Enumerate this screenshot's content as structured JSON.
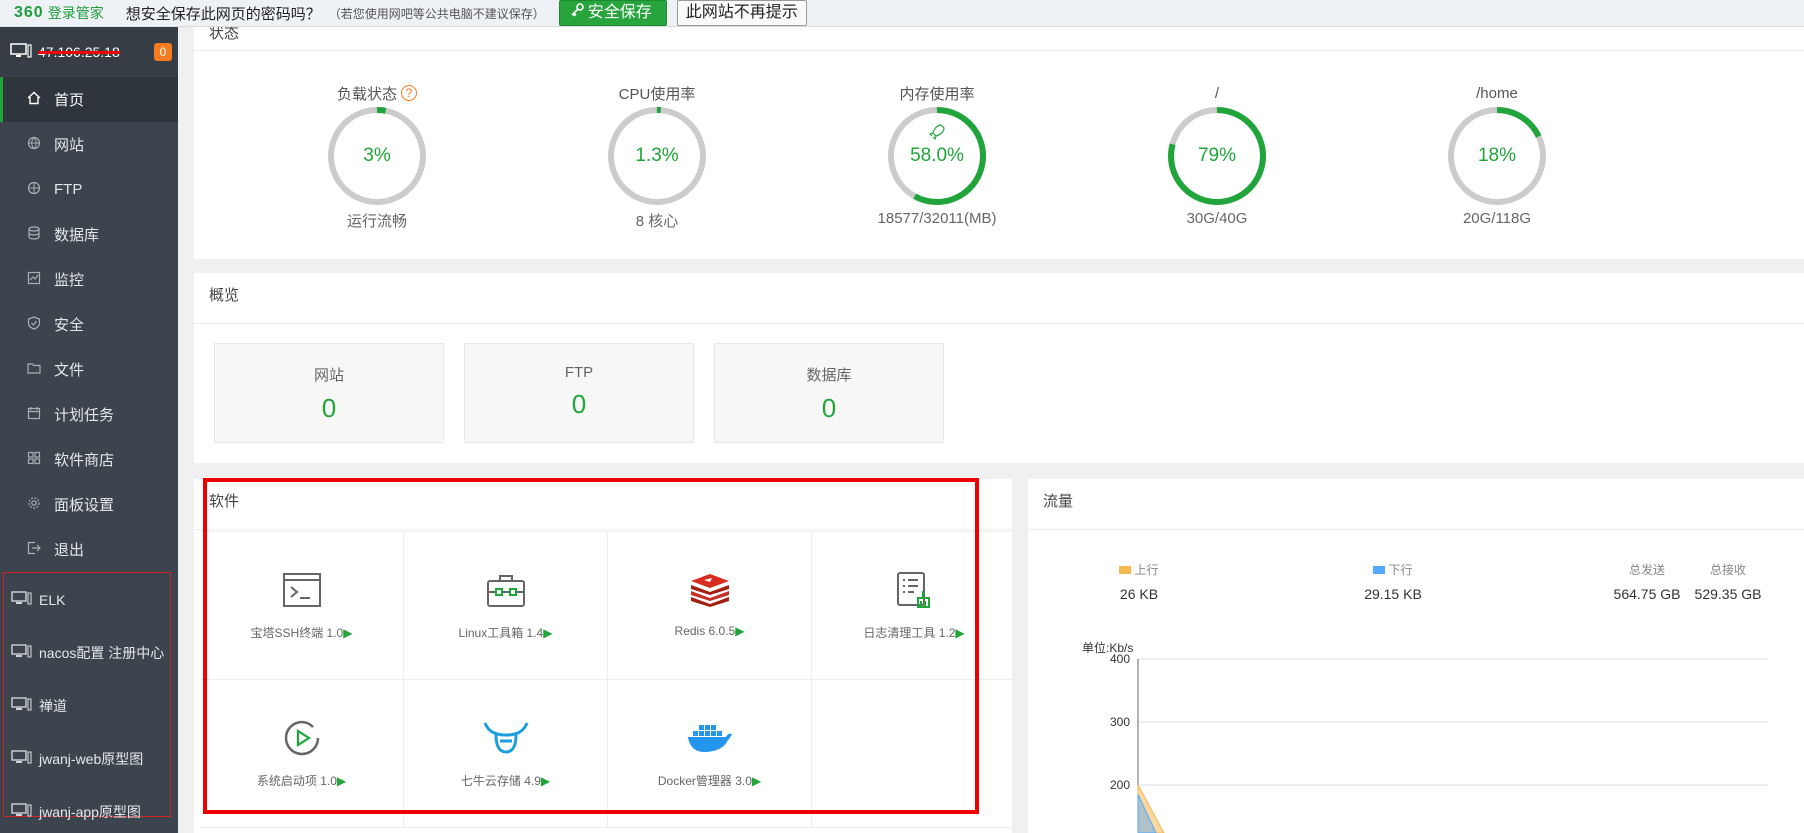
{
  "bar360": {
    "logo": "360",
    "logo_text": "登录管家",
    "question": "想安全保存此网页的密码吗？",
    "hint": "（若您使用网吧等公共电脑不建议保存）",
    "save_label": "安全保存",
    "no_prompt_label": "此网站不再提示"
  },
  "sidebar": {
    "server_ip": "47.106.25.18",
    "badge": "0",
    "nav": [
      {
        "label": "首页",
        "icon": "home-icon"
      },
      {
        "label": "网站",
        "icon": "globe-icon"
      },
      {
        "label": "FTP",
        "icon": "ftp-icon"
      },
      {
        "label": "数据库",
        "icon": "database-icon"
      },
      {
        "label": "监控",
        "icon": "monitor-icon"
      },
      {
        "label": "安全",
        "icon": "shield-icon"
      },
      {
        "label": "文件",
        "icon": "folder-icon"
      },
      {
        "label": "计划任务",
        "icon": "calendar-icon"
      },
      {
        "label": "软件商店",
        "icon": "grid-icon"
      },
      {
        "label": "面板设置",
        "icon": "gear-icon"
      },
      {
        "label": "退出",
        "icon": "logout-icon"
      }
    ],
    "servers": [
      "ELK",
      "nacos配置 注册中心",
      "禅道",
      "jwanj-web原型图",
      "jwanj-app原型图"
    ]
  },
  "status": {
    "title": "状态",
    "gauges": [
      {
        "label": "负载状态",
        "value": "3%",
        "fraction": 0.03,
        "sub": "运行流畅"
      },
      {
        "label": "CPU使用率",
        "value": "1.3%",
        "fraction": 0.013,
        "sub": "8 核心"
      },
      {
        "label": "内存使用率",
        "value": "58.0%",
        "fraction": 0.58,
        "sub": "18577/32011(MB)"
      },
      {
        "label": "/",
        "value": "79%",
        "fraction": 0.79,
        "sub": "30G/40G"
      },
      {
        "label": "/home",
        "value": "18%",
        "fraction": 0.18,
        "sub": "20G/118G"
      }
    ]
  },
  "overview": {
    "title": "概览",
    "cards": [
      {
        "label": "网站",
        "value": "0"
      },
      {
        "label": "FTP",
        "value": "0"
      },
      {
        "label": "数据库",
        "value": "0"
      }
    ]
  },
  "software": {
    "title": "软件",
    "items": [
      {
        "name": "宝塔SSH终端 1.0",
        "icon": "terminal-icon"
      },
      {
        "name": "Linux工具箱 1.4",
        "icon": "toolbox-icon"
      },
      {
        "name": "Redis 6.0.5",
        "icon": "redis-icon"
      },
      {
        "name": "日志清理工具 1.2",
        "icon": "log-clean-icon"
      },
      {
        "name": "系统启动项 1.0",
        "icon": "startup-icon"
      },
      {
        "name": "七牛云存储 4.9",
        "icon": "qiniu-icon"
      },
      {
        "name": "Docker管理器 3.0",
        "icon": "docker-icon"
      }
    ],
    "arrow": "▶"
  },
  "traffic": {
    "title": "流量",
    "stats": [
      {
        "label": "上行",
        "value": "26 KB",
        "color": "#f7b851"
      },
      {
        "label": "下行",
        "value": "29.15 KB",
        "color": "#52a9ff"
      },
      {
        "label": "总发送",
        "value": "564.75 GB"
      },
      {
        "label": "总接收",
        "value": "529.35 GB"
      }
    ],
    "unit_label": "单位:Kb/s"
  },
  "chart_data": {
    "type": "area",
    "ylabel": "单位:Kb/s",
    "y_ticks": [
      "400",
      "300",
      "200"
    ],
    "ylim": [
      100,
      400
    ],
    "series": [
      {
        "name": "上行",
        "color": "#f7b851",
        "values": [
          200,
          120
        ]
      },
      {
        "name": "下行",
        "color": "#52a9ff",
        "values": [
          185,
          110
        ]
      }
    ]
  }
}
